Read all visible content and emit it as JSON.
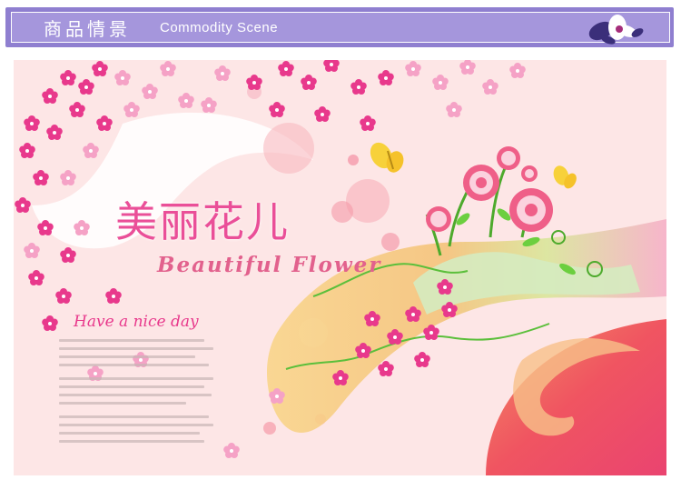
{
  "header": {
    "title_cn": "商品情景",
    "title_en": "Commodity  Scene"
  },
  "poster": {
    "title_cn": "美丽花儿",
    "title_en": "Beautiful Flower",
    "tagline": "Have a nice day"
  },
  "colors": {
    "header_purple": "#8f7fd0",
    "poster_pink": "#fde6e6",
    "flower_magenta": "#e8398c",
    "swirl_red": "#ef5a4f"
  },
  "icons": [
    "flower-logo-icon",
    "butterfly-icon",
    "blossom-icon"
  ]
}
